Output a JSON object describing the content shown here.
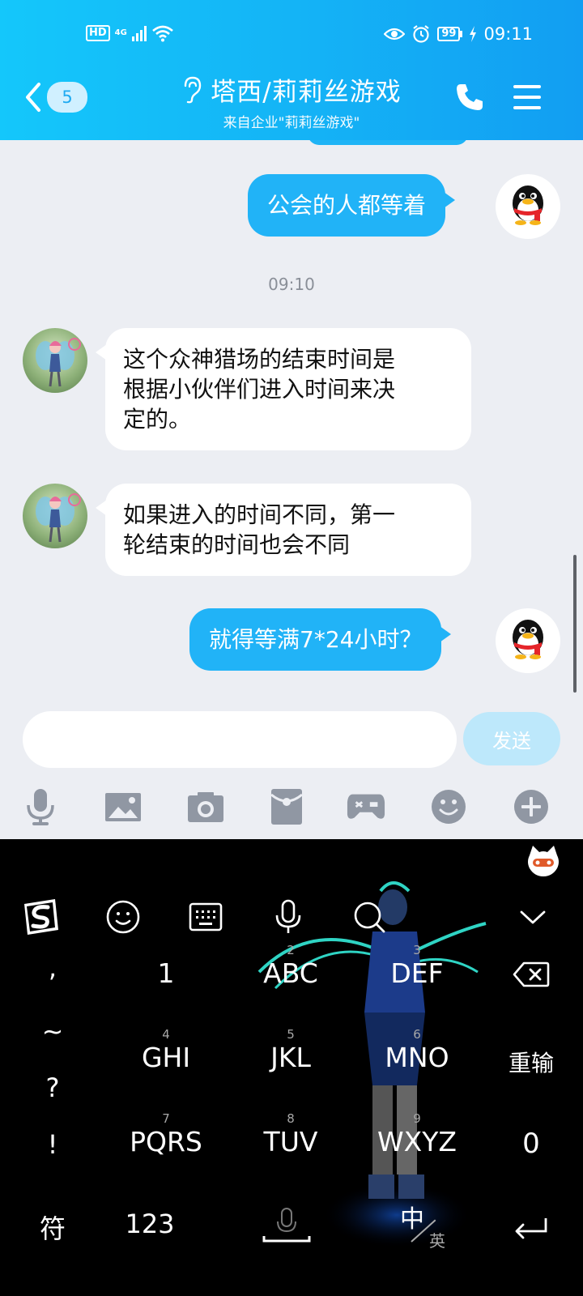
{
  "status_bar": {
    "hd": "HD",
    "network": "4G",
    "battery": "99",
    "time": "09:11"
  },
  "header": {
    "back_count": "5",
    "title": "塔西/莉莉丝游戏",
    "subtitle": "来自企业\"莉莉丝游戏\""
  },
  "messages": [
    {
      "side": "right",
      "text": "公会的人都等着"
    },
    {
      "side": "time",
      "text": "09:10"
    },
    {
      "side": "left",
      "lines": [
        "这个众神猎场的结束时间是",
        "根据小伙伴们进入时间来决",
        "定的。"
      ]
    },
    {
      "side": "left",
      "lines": [
        "如果进入的时间不同，第一",
        "轮结束的时间也会不同"
      ]
    },
    {
      "side": "right",
      "text": "就得等满7*24小时？"
    }
  ],
  "input": {
    "value": "",
    "send_label": "发送"
  },
  "tools": [
    "mic-icon",
    "image-icon",
    "camera-icon",
    "red-packet-icon",
    "game-icon",
    "emoji-icon",
    "plus-icon"
  ],
  "keyboard": {
    "punct": [
      ",",
      "~",
      "?",
      "!"
    ],
    "keys": [
      {
        "sub": "",
        "main": "1"
      },
      {
        "sub": "2",
        "main": "ABC"
      },
      {
        "sub": "3",
        "main": "DEF"
      },
      {
        "sub": "4",
        "main": "GHI"
      },
      {
        "sub": "5",
        "main": "JKL"
      },
      {
        "sub": "6",
        "main": "MNO"
      },
      {
        "sub": "7",
        "main": "PQRS"
      },
      {
        "sub": "8",
        "main": "TUV"
      },
      {
        "sub": "9",
        "main": "WXYZ"
      }
    ],
    "retype": "重输",
    "zero": "0",
    "symbols": "符",
    "numbers": "123",
    "lang_zh": "中",
    "lang_en": "英"
  }
}
